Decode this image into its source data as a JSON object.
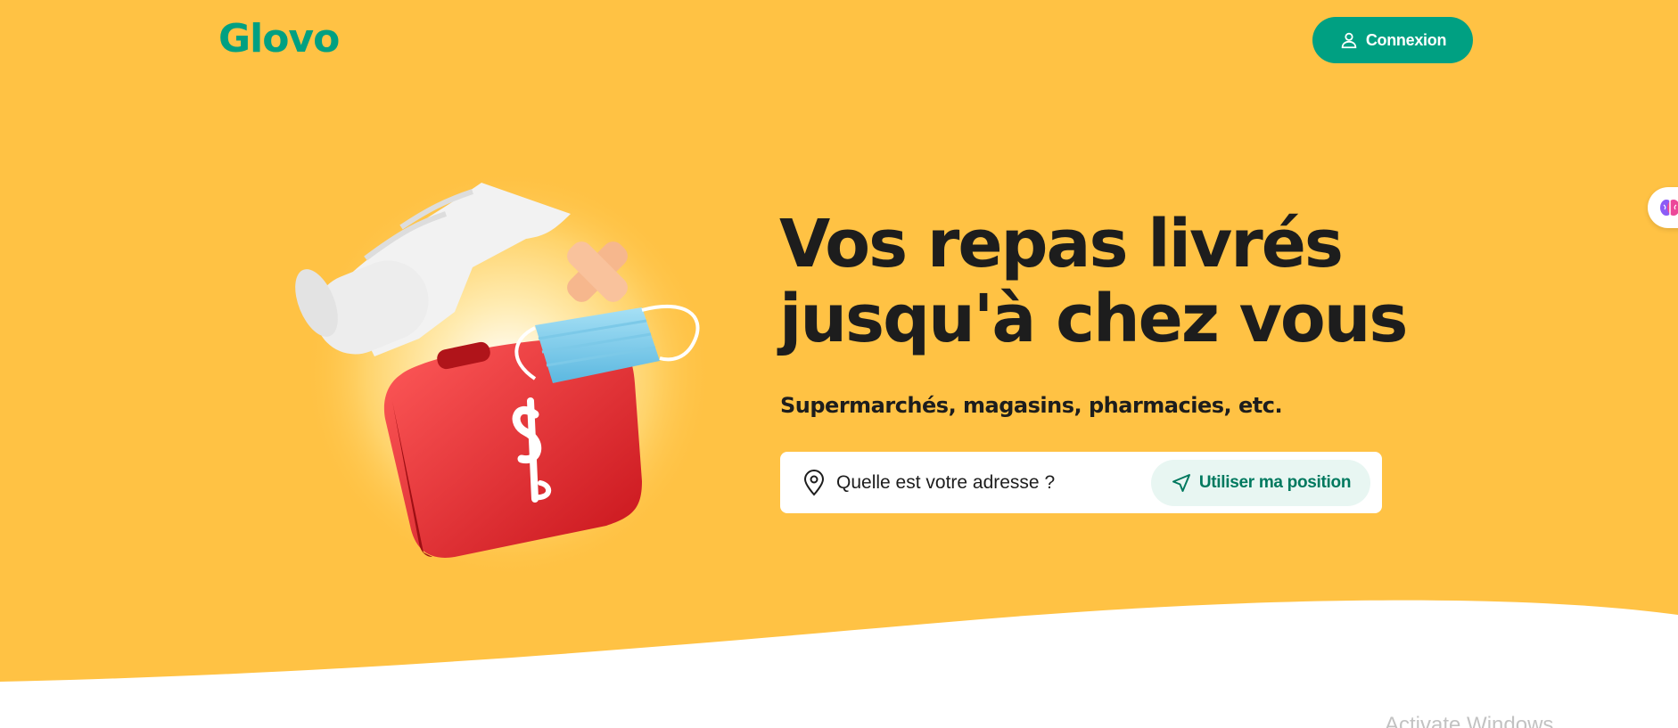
{
  "header": {
    "logo": "Glovo",
    "login_label": "Connexion"
  },
  "hero": {
    "headline": "Vos repas livrés jusqu'à chez vous",
    "subtitle": "Supermarchés, magasins, pharmacies, etc."
  },
  "address": {
    "placeholder": "Quelle est votre adresse ?",
    "position_button": "Utiliser ma position"
  },
  "watermark": "Activate Windows",
  "colors": {
    "brand_green": "#00A082",
    "background_yellow": "#FFC244",
    "position_button_bg": "#E8F6F2",
    "text_dark": "#1d1d1d"
  },
  "icons": {
    "login": "user-icon",
    "address": "location-pin-icon",
    "position": "navigation-arrow-icon",
    "side": "brain-icon"
  }
}
